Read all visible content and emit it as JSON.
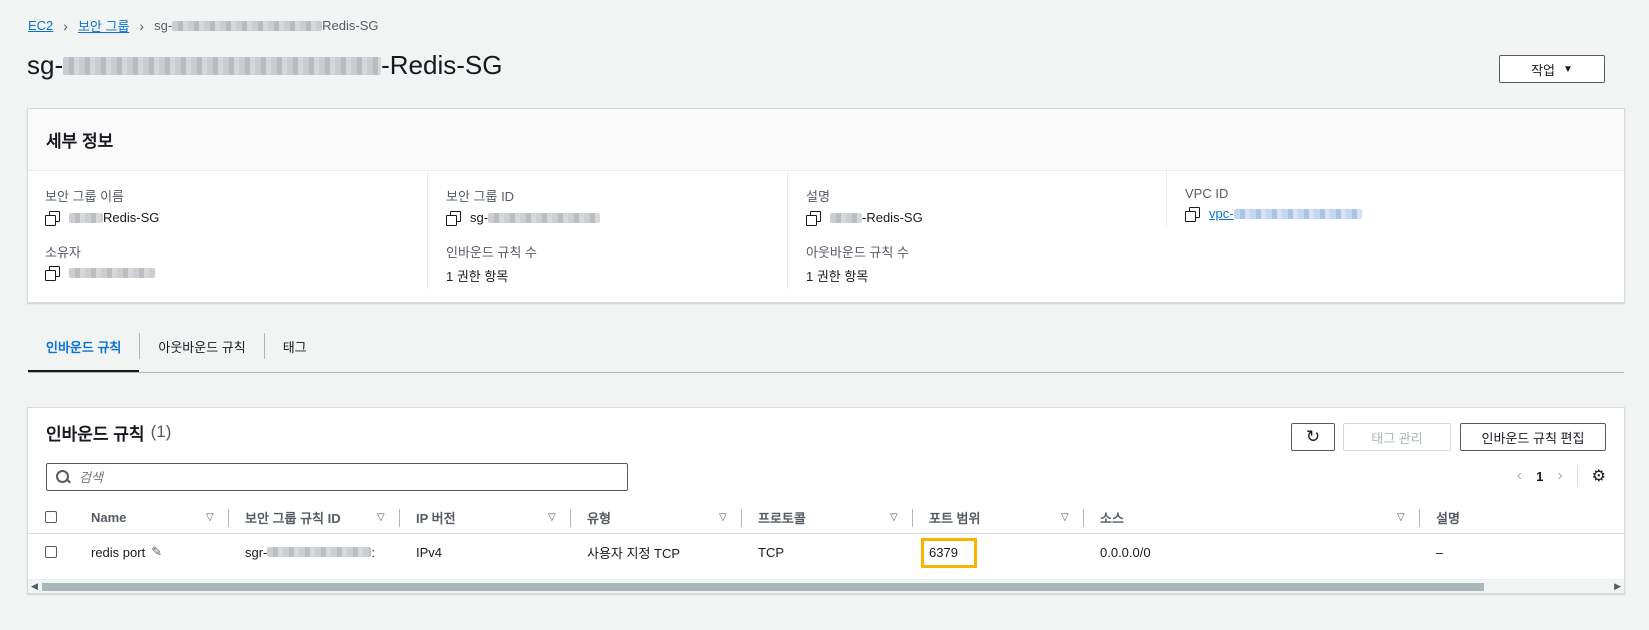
{
  "breadcrumb": {
    "ec2": "EC2",
    "sg": "보안 그룹",
    "current_prefix": "sg-",
    "current_suffix": "Redis-SG"
  },
  "title": {
    "prefix": "sg-",
    "suffix": "-Redis-SG"
  },
  "action_label": "작업",
  "details": {
    "header": "세부 정보",
    "sg_name_label": "보안 그룹 이름",
    "sg_name_value": "Redis-SG",
    "sg_id_label": "보안 그룹 ID",
    "sg_id_value": "sg-",
    "desc_label": "설명",
    "desc_value": "-Redis-SG",
    "vpc_label": "VPC ID",
    "vpc_value": "vpc-",
    "owner_label": "소유자",
    "inbound_count_label": "인바운드 규칙 수",
    "inbound_count_value": "1 권한 항목",
    "outbound_count_label": "아웃바운드 규칙 수",
    "outbound_count_value": "1 권한 항목"
  },
  "tabs": [
    {
      "label": "인바운드 규칙"
    },
    {
      "label": "아웃바운드 규칙"
    },
    {
      "label": "태그"
    }
  ],
  "rules": {
    "title": "인바운드 규칙",
    "count": "(1)",
    "tag_button": "태그 관리",
    "edit_button": "인바운드 규칙 편집",
    "search_placeholder": "검색",
    "page": "1",
    "columns": [
      "Name",
      "보안 그룹 규칙 ID",
      "IP 버전",
      "유형",
      "프로토콜",
      "포트 범위",
      "소스",
      "설명"
    ],
    "row": {
      "name": "redis port",
      "rule_id_prefix": "sgr-",
      "rule_id_suffix": ":",
      "ip_version": "IPv4",
      "type": "사용자 지정 TCP",
      "protocol": "TCP",
      "port_range": "6379",
      "source": "0.0.0.0/0",
      "description": "–"
    }
  },
  "colors": {
    "link": "#0972d3",
    "highlight": "#f7b500"
  }
}
